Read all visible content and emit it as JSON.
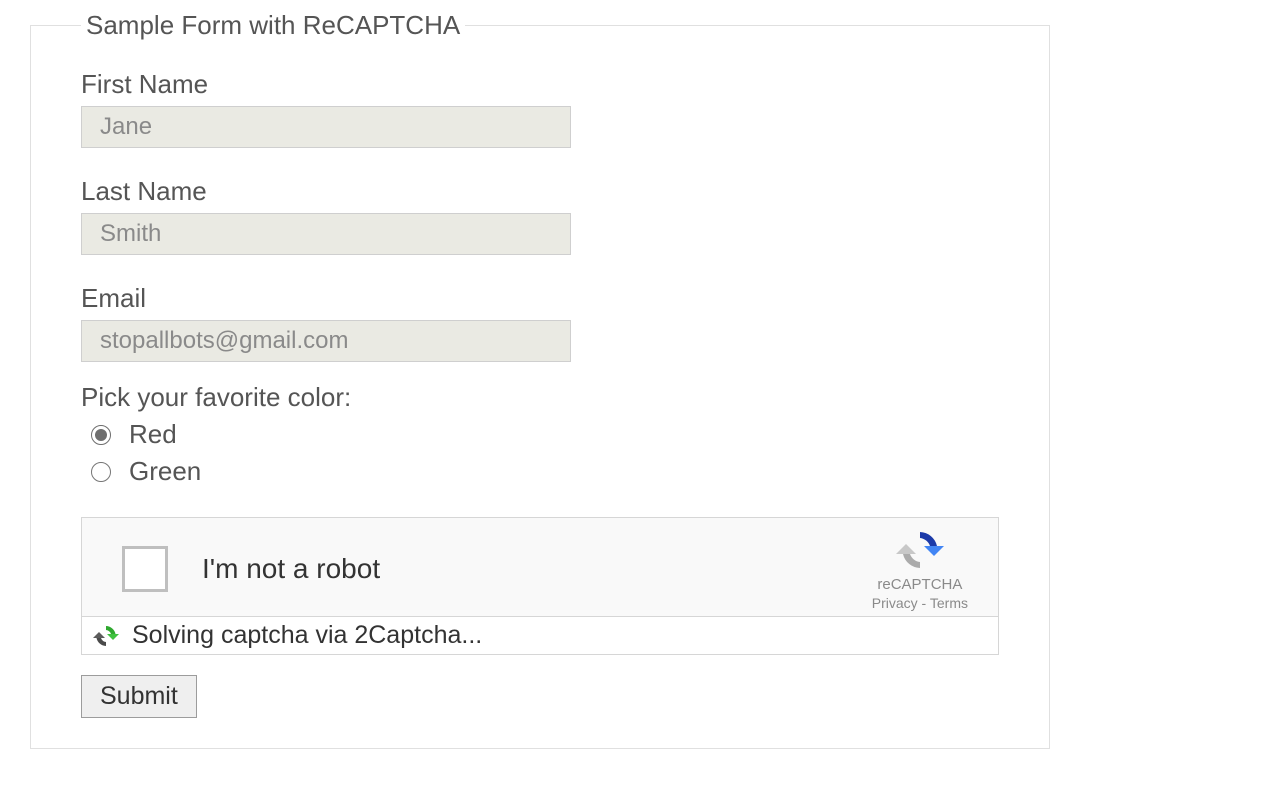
{
  "form": {
    "legend": "Sample Form with ReCAPTCHA",
    "fields": {
      "firstName": {
        "label": "First Name",
        "placeholder": "Jane",
        "value": ""
      },
      "lastName": {
        "label": "Last Name",
        "placeholder": "Smith",
        "value": ""
      },
      "email": {
        "label": "Email",
        "placeholder": "stopallbots@gmail.com",
        "value": ""
      }
    },
    "colorPicker": {
      "prompt": "Pick your favorite color:",
      "options": [
        {
          "label": "Red",
          "selected": true
        },
        {
          "label": "Green",
          "selected": false
        }
      ]
    },
    "recaptcha": {
      "checkboxLabel": "I'm not a robot",
      "brand": "reCAPTCHA",
      "privacyLabel": "Privacy",
      "separator": " - ",
      "termsLabel": "Terms",
      "solvingText": "Solving captcha via 2Captcha..."
    },
    "submitLabel": "Submit"
  }
}
